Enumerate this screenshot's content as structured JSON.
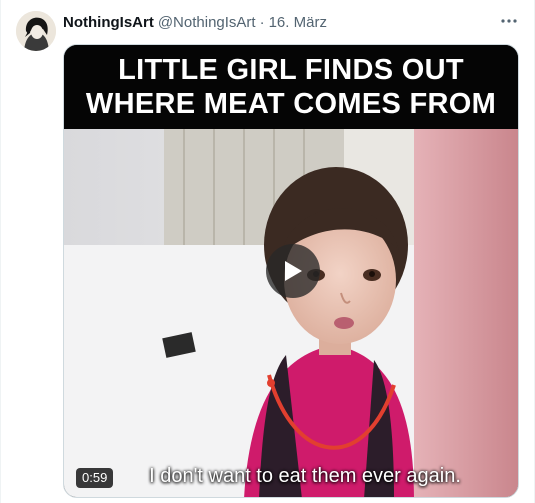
{
  "tweet": {
    "display_name": "NothingIsArt",
    "handle": "@NothingIsArt",
    "separator": "·",
    "date": "16. März",
    "more_icon": "more-horizontal-icon"
  },
  "video": {
    "caption_line1": "LITTLE GIRL FINDS OUT",
    "caption_line2": "WHERE MEAT COMES FROM",
    "subtitle": "I don't want to eat them ever again.",
    "duration": "0:59",
    "play_icon": "play-icon"
  },
  "colors": {
    "text_primary": "#0f1419",
    "text_secondary": "#536471",
    "caption_bg": "#050505",
    "dress_pink": "#d91a6e"
  }
}
